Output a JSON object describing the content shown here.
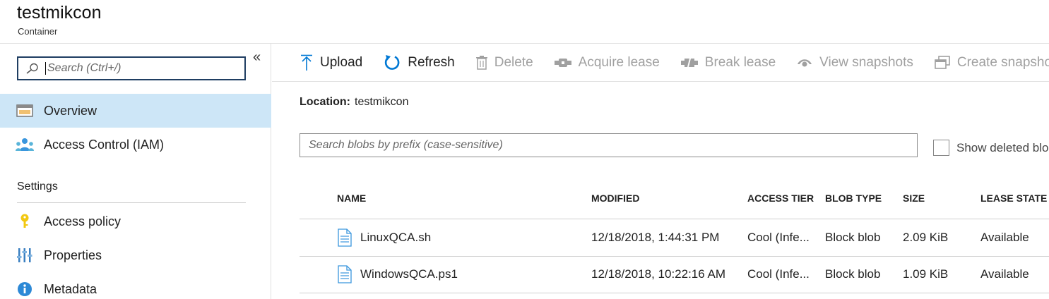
{
  "header": {
    "title": "testmikcon",
    "subtitle": "Container"
  },
  "sidebar": {
    "search_placeholder": "Search (Ctrl+/)",
    "collapse_icon": "«",
    "items": [
      {
        "label": "Overview",
        "icon": "overview-icon",
        "active": true
      },
      {
        "label": "Access Control (IAM)",
        "icon": "iam-icon",
        "active": false
      }
    ],
    "settings": {
      "label": "Settings",
      "items": [
        {
          "label": "Access policy",
          "icon": "key-icon"
        },
        {
          "label": "Properties",
          "icon": "properties-icon"
        },
        {
          "label": "Metadata",
          "icon": "info-icon"
        }
      ]
    }
  },
  "toolbar": {
    "upload": "Upload",
    "refresh": "Refresh",
    "delete": "Delete",
    "acquire_lease": "Acquire lease",
    "break_lease": "Break lease",
    "view_snapshots": "View snapshots",
    "create_snapshot": "Create snapshot"
  },
  "location": {
    "label": "Location:",
    "value": "testmikcon"
  },
  "blob_search": {
    "placeholder": "Search blobs by prefix (case-sensitive)"
  },
  "show_deleted": {
    "label": "Show deleted blobs",
    "checked": false
  },
  "table": {
    "columns": [
      "NAME",
      "MODIFIED",
      "ACCESS TIER",
      "BLOB TYPE",
      "SIZE",
      "LEASE STATE"
    ],
    "rows": [
      {
        "name": "LinuxQCA.sh",
        "modified": "12/18/2018, 1:44:31 PM",
        "access_tier": "Cool (Infe...",
        "blob_type": "Block blob",
        "size": "2.09 KiB",
        "lease_state": "Available"
      },
      {
        "name": "WindowsQCA.ps1",
        "modified": "12/18/2018, 10:22:16 AM",
        "access_tier": "Cool (Infe...",
        "blob_type": "Block blob",
        "size": "1.09 KiB",
        "lease_state": "Available"
      }
    ]
  },
  "colors": {
    "accent": "#0078d4",
    "active_bg": "#cde6f7",
    "search_border": "#1f3e62",
    "disabled": "#a0a0a0"
  }
}
